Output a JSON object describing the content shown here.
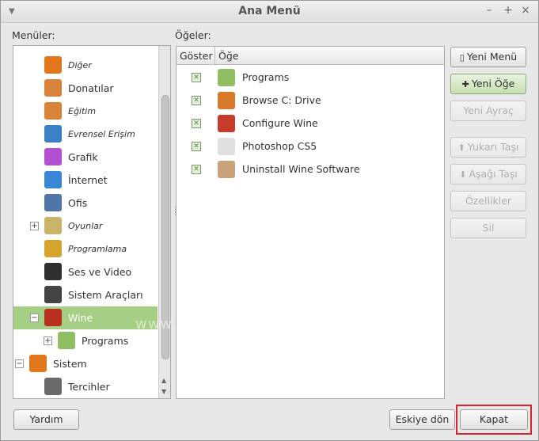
{
  "window": {
    "title": "Ana Menü"
  },
  "labels": {
    "menus": "Menüler:",
    "items": "Öğeler:"
  },
  "tree": [
    {
      "label": "Diğer",
      "italic": true,
      "icon": "other-icon",
      "color": "#e2761b",
      "indent": 1
    },
    {
      "label": "Donatılar",
      "italic": false,
      "icon": "accessories-icon",
      "color": "#d9823a",
      "indent": 1
    },
    {
      "label": "Eğitim",
      "italic": true,
      "icon": "education-icon",
      "color": "#d9823a",
      "indent": 1
    },
    {
      "label": "Evrensel Erişim",
      "italic": true,
      "icon": "accessibility-icon",
      "color": "#3b7fc4",
      "indent": 1
    },
    {
      "label": "Grafik",
      "italic": false,
      "icon": "graphics-icon",
      "color": "#b34fd1",
      "indent": 1
    },
    {
      "label": "İnternet",
      "italic": false,
      "icon": "internet-icon",
      "color": "#3a85d6",
      "indent": 1
    },
    {
      "label": "Ofis",
      "italic": false,
      "icon": "office-icon",
      "color": "#4f76a8",
      "indent": 1
    },
    {
      "label": "Oyunlar",
      "italic": true,
      "icon": "games-icon",
      "color": "#c9b46a",
      "indent": 1,
      "expander": "+"
    },
    {
      "label": "Programlama",
      "italic": true,
      "icon": "programming-icon",
      "color": "#d6a32c",
      "indent": 1
    },
    {
      "label": "Ses ve Video",
      "italic": false,
      "icon": "multimedia-icon",
      "color": "#2f2f2f",
      "indent": 1
    },
    {
      "label": "Sistem Araçları",
      "italic": false,
      "icon": "system-tools-icon",
      "color": "#444444",
      "indent": 1
    },
    {
      "label": "Wine",
      "italic": false,
      "icon": "wine-icon",
      "color": "#b8301f",
      "indent": 1,
      "expander": "−",
      "selected": true
    },
    {
      "label": "Programs",
      "italic": false,
      "icon": "folder-icon",
      "color": "#8fbf62",
      "indent": 2,
      "expander": "+"
    },
    {
      "label": "Sistem",
      "italic": false,
      "icon": "system-icon",
      "color": "#e2761b",
      "indent": 0,
      "expander": "−"
    },
    {
      "label": "Tercihler",
      "italic": false,
      "icon": "preferences-icon",
      "color": "#6a6a6a",
      "indent": 1
    }
  ],
  "list": {
    "col_show": "Göster",
    "col_item": "Öğe",
    "rows": [
      {
        "label": "Programs",
        "icon": "folder-icon",
        "color": "#8fbf62",
        "checked": true
      },
      {
        "label": "Browse C: Drive",
        "icon": "browse-drive-icon",
        "color": "#d97a2a",
        "checked": true
      },
      {
        "label": "Configure Wine",
        "icon": "configure-wine-icon",
        "color": "#c83a2a",
        "checked": true
      },
      {
        "label": "Photoshop CS5",
        "icon": "photoshop-icon",
        "color": "#e0e0e0",
        "checked": true
      },
      {
        "label": "Uninstall Wine Software",
        "icon": "uninstall-icon",
        "color": "#c9a27a",
        "checked": true
      }
    ]
  },
  "buttons": {
    "new_menu": "Yeni Menü",
    "new_item": "Yeni Öğe",
    "new_separator": "Yeni Ayraç",
    "move_up": "Yukarı Taşı",
    "move_down": "Aşağı Taşı",
    "properties": "Özellikler",
    "delete": "Sil",
    "help": "Yardım",
    "revert": "Eskiye dön",
    "close": "Kapat"
  },
  "watermark": "www.ipucumu.com"
}
